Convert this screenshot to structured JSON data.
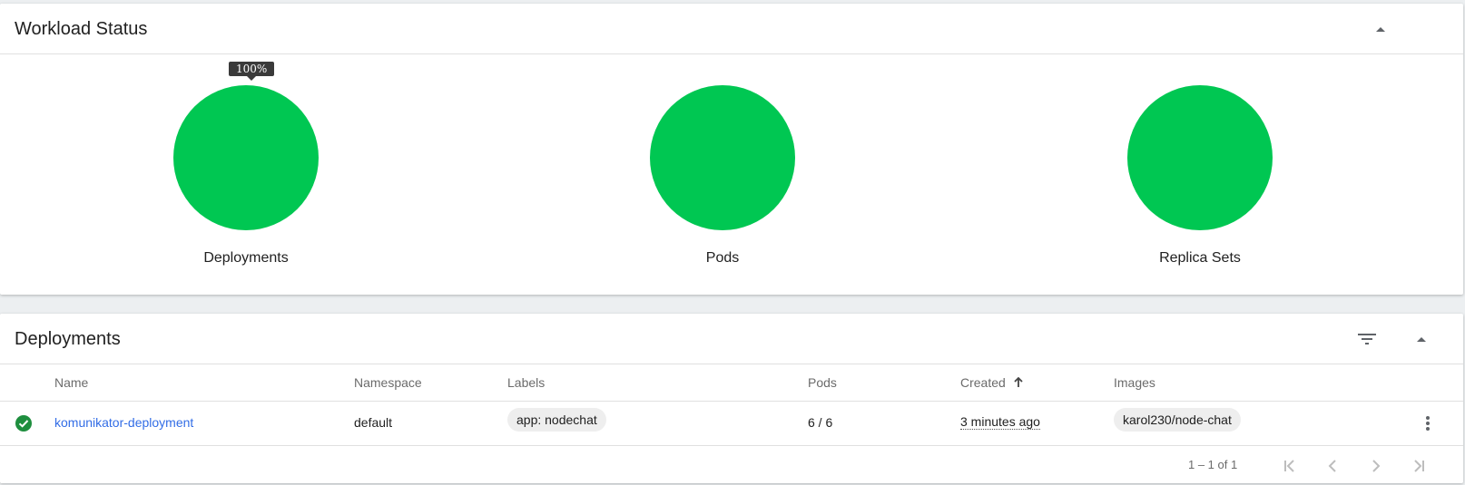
{
  "workload_status": {
    "title": "Workload Status",
    "tooltip": "100%",
    "charts": [
      {
        "label": "Deployments",
        "running_percent": 100,
        "color": "#00c752"
      },
      {
        "label": "Pods",
        "running_percent": 100,
        "color": "#00c752"
      },
      {
        "label": "Replica Sets",
        "running_percent": 100,
        "color": "#00c752"
      }
    ],
    "icons": {
      "collapse": "chevron-up-icon"
    }
  },
  "deployments": {
    "title": "Deployments",
    "icons": {
      "filter": "filter-icon",
      "collapse": "chevron-up-icon",
      "sort": "arrow-up-icon",
      "status": "check-circle-icon",
      "menu": "more-vert-icon"
    },
    "columns": [
      "Name",
      "Namespace",
      "Labels",
      "Pods",
      "Created",
      "Images"
    ],
    "rows": [
      {
        "status": "running",
        "name": "komunikator-deployment",
        "namespace": "default",
        "labels": "app: nodechat",
        "pods": "6 / 6",
        "created": "3 minutes ago",
        "images": "karol230/node-chat"
      }
    ],
    "pagination": {
      "range": "1 – 1 of 1"
    }
  },
  "colors": {
    "success": "#00c752",
    "status_ok": "#1e8e3e",
    "link": "#326de6"
  }
}
